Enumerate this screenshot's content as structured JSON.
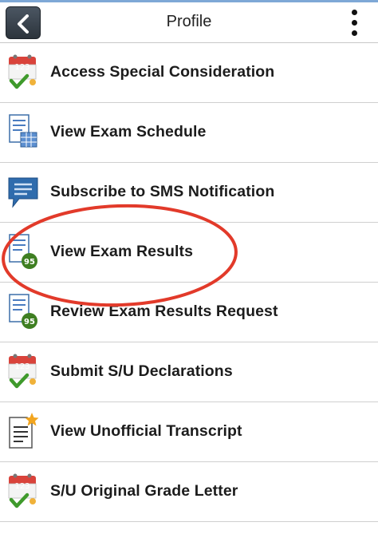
{
  "header": {
    "title": "Profile"
  },
  "menu": [
    {
      "label": "Access Special Consideration",
      "icon": "calendar-123-check-icon"
    },
    {
      "label": "View Exam Schedule",
      "icon": "document-calendar-icon"
    },
    {
      "label": "Subscribe to SMS Notification",
      "icon": "speech-bubble-icon"
    },
    {
      "label": "View Exam Results",
      "icon": "document-95-badge-icon"
    },
    {
      "label": "Review Exam Results Request",
      "icon": "document-95-badge-icon"
    },
    {
      "label": "Submit S/U Declarations",
      "icon": "calendar-123-check-icon"
    },
    {
      "label": "View Unofficial Transcript",
      "icon": "document-star-icon"
    },
    {
      "label": "S/U Original Grade Letter",
      "icon": "calendar-123-check-icon"
    }
  ],
  "badges": {
    "calendar": "123",
    "score": "95"
  },
  "colors": {
    "annotation_circle": "#e23a2a",
    "badge_green": "#3f7f22",
    "calendar_red": "#d9433b",
    "bubble_blue": "#2f6cad"
  }
}
